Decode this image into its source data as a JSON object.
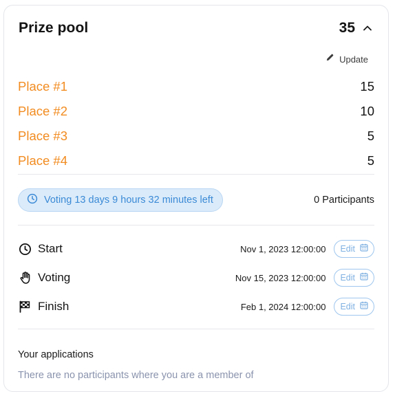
{
  "prize_pool": {
    "title": "Prize pool",
    "total": "35",
    "update_label": "Update",
    "places": [
      {
        "label": "Place #1",
        "value": "15"
      },
      {
        "label": "Place #2",
        "value": "10"
      },
      {
        "label": "Place #3",
        "value": "5"
      },
      {
        "label": "Place #4",
        "value": "5"
      }
    ]
  },
  "status": {
    "voting_text": "Voting 13 days 9 hours 32 minutes left",
    "participants_text": "0 Participants"
  },
  "timeline": [
    {
      "label": "Start",
      "date": "Nov 1, 2023 12:00:00",
      "edit_label": "Edit",
      "icon": "clock-icon"
    },
    {
      "label": "Voting",
      "date": "Nov 15, 2023 12:00:00",
      "edit_label": "Edit",
      "icon": "hand-icon"
    },
    {
      "label": "Finish",
      "date": "Feb 1, 2024 12:00:00",
      "edit_label": "Edit",
      "icon": "checkered-flag-icon"
    }
  ],
  "applications": {
    "title": "Your applications",
    "empty_text": "There are no participants where you are a member of"
  },
  "colors": {
    "place_label": "#f28c21",
    "accent_blue": "#3a8ad6",
    "badge_bg": "#dcebfa",
    "muted_text": "#8a93ad"
  }
}
